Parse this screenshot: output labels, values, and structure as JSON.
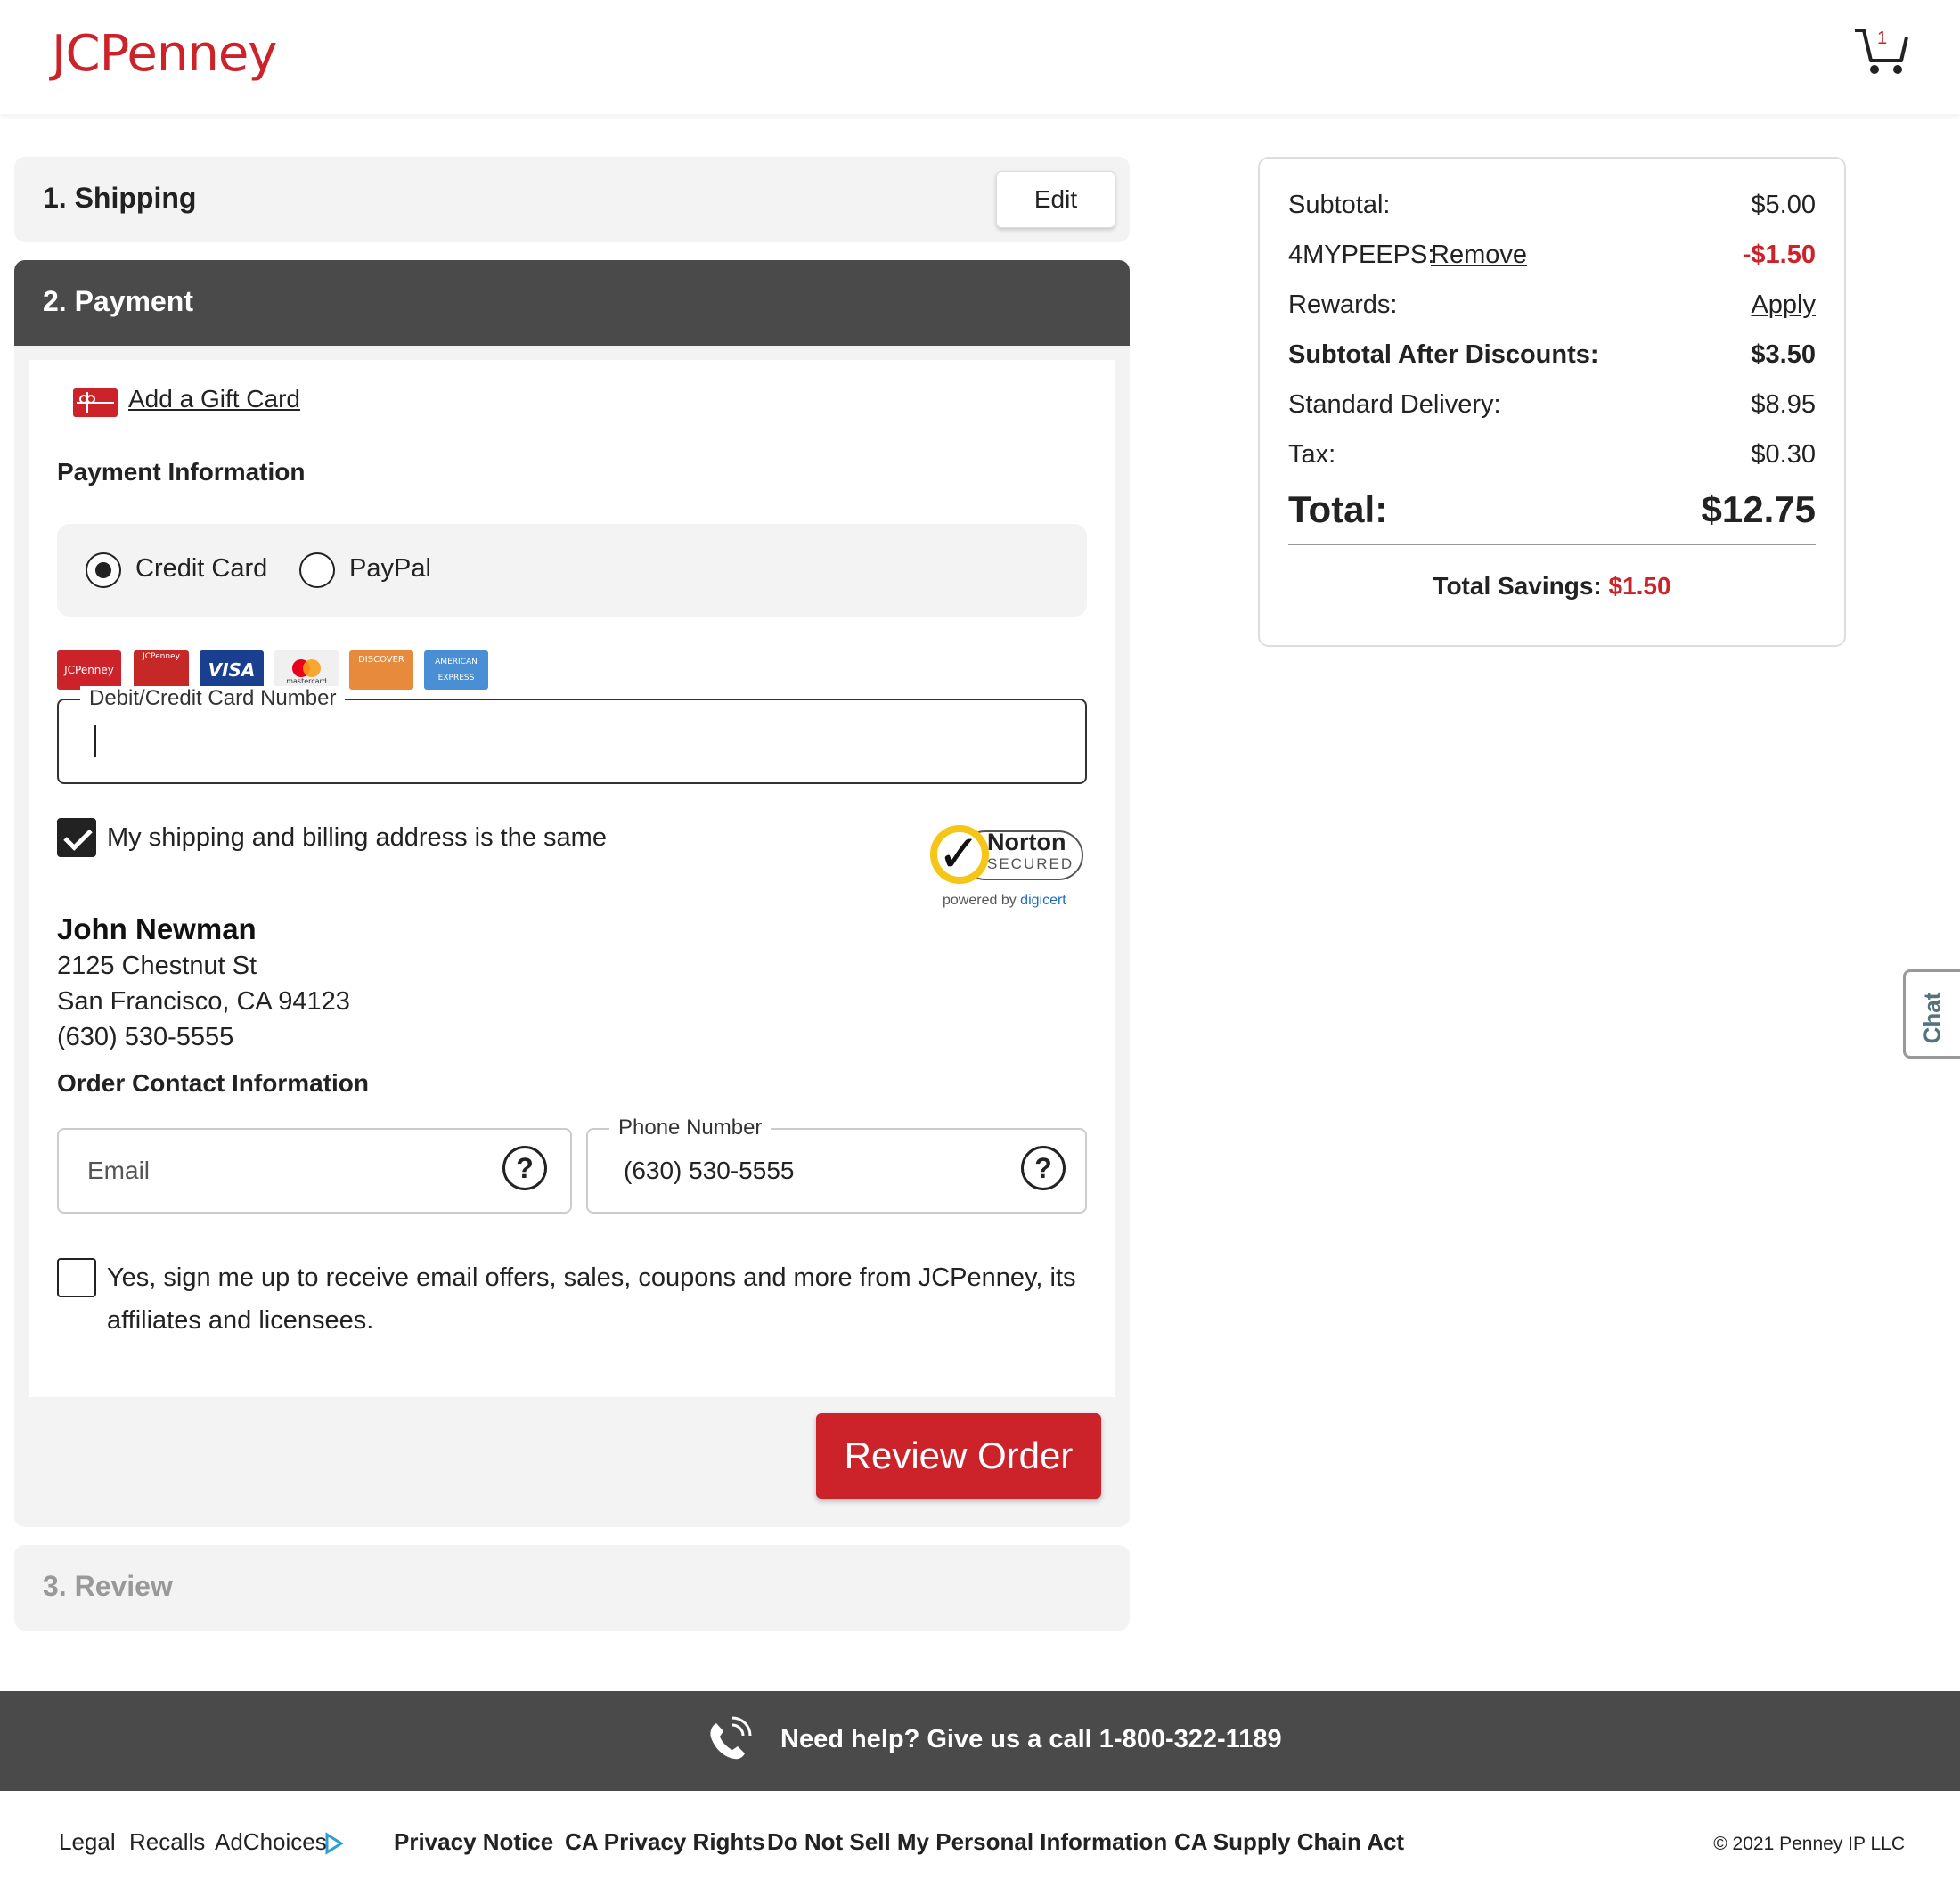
{
  "header": {
    "logo": "JCPenney",
    "cart_count": "1"
  },
  "steps": {
    "shipping": {
      "title": "1. Shipping",
      "edit_label": "Edit"
    },
    "payment": {
      "title": "2. Payment"
    },
    "review": {
      "title": "3. Review"
    }
  },
  "payment": {
    "gift_card_link": "Add a Gift Card",
    "section_title": "Payment Information",
    "methods": [
      {
        "label": "Credit Card",
        "selected": true
      },
      {
        "label": "PayPal",
        "selected": false
      }
    ],
    "card_logos": [
      "JCPenney",
      "JCPenney",
      "VISA",
      "mastercard",
      "DISCOVER",
      "AMERICAN EXPRESS"
    ],
    "card_number_label": "Debit/Credit Card Number",
    "card_number_value": "",
    "same_address_label": "My shipping and billing address is the same",
    "same_address_checked": true,
    "norton": {
      "word": "Norton",
      "secured": "SECURED",
      "powered": "powered by",
      "brand": "digicert"
    },
    "address": {
      "name": "John Newman",
      "street": "2125 Chestnut St",
      "city": "San Francisco, CA 94123",
      "phone": "(630) 530-5555"
    },
    "contact_title": "Order Contact Information",
    "email_placeholder": "Email",
    "phone_label": "Phone Number",
    "phone_value": "(630) 530-5555",
    "optin_line1": "Yes, sign me up to receive email offers, sales, coupons and more from JCPenney, its",
    "optin_line2": "affiliates and licensees.",
    "optin_checked": false,
    "review_button": "Review Order"
  },
  "summary": {
    "subtotal_label": "Subtotal:",
    "subtotal_value": "$5.00",
    "promo_code": "4MYPEEPS:",
    "promo_remove": "Remove",
    "promo_value": "-$1.50",
    "rewards_label": "Rewards:",
    "rewards_apply": "Apply",
    "after_label": "Subtotal After Discounts:",
    "after_value": "$3.50",
    "delivery_label": "Standard Delivery:",
    "delivery_value": "$8.95",
    "tax_label": "Tax:",
    "tax_value": "$0.30",
    "total_label": "Total:",
    "total_value": "$12.75",
    "savings_label": "Total Savings:",
    "savings_value": "$1.50"
  },
  "chat_label": "Chat",
  "footer": {
    "help_text": "Need help? Give us a call 1-800-322-1189",
    "links_plain": [
      "Legal",
      "Recalls",
      "AdChoices"
    ],
    "links_bold": [
      "Privacy Notice",
      "CA Privacy Rights",
      "Do Not Sell My Personal Information",
      "CA Supply Chain Act"
    ],
    "copyright": "© 2021 Penney IP LLC"
  },
  "colors": {
    "brand_red": "#cc2229",
    "dark_bar": "#4a4a4a",
    "panel_gray": "#f3f3f3"
  }
}
